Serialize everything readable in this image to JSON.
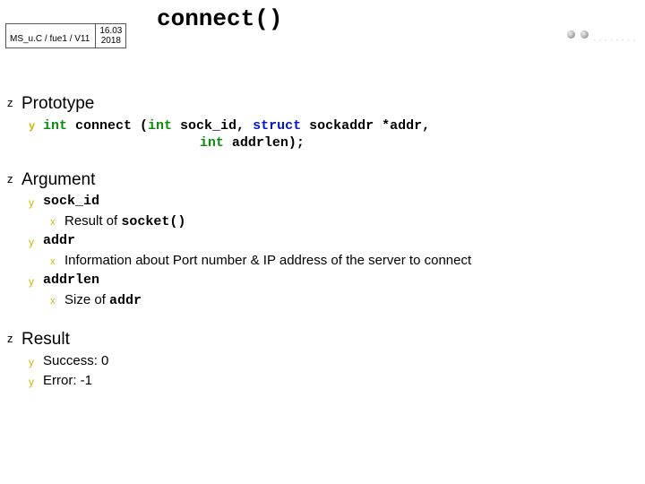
{
  "header": {
    "course": "MS_u.C / fue1 / V11",
    "date_top": "16.03",
    "date_bottom": "2018"
  },
  "title": "connect()",
  "bullets": {
    "z": "z",
    "y": "y",
    "x": "x"
  },
  "sections": {
    "prototype": {
      "heading": "Prototype",
      "code_int": "int",
      "code_seg1": " connect (",
      "code_int2": "int",
      "code_seg2": " sock_id, ",
      "code_struct": "struct",
      "code_seg3": " sockaddr *addr,",
      "code_int3": "int",
      "code_seg4": " addrlen);"
    },
    "argument": {
      "heading": "Argument",
      "items": [
        {
          "name": "sock_id",
          "desc_pre": "Result of ",
          "desc_code": "socket()"
        },
        {
          "name": "addr",
          "desc_pre": "Information about Port number & IP address of the server to connect",
          "desc_code": ""
        },
        {
          "name": "addrlen",
          "desc_pre": "Size of ",
          "desc_code": "addr"
        }
      ]
    },
    "result": {
      "heading": "Result",
      "items": [
        "Success: 0",
        "Error: -1"
      ]
    }
  }
}
